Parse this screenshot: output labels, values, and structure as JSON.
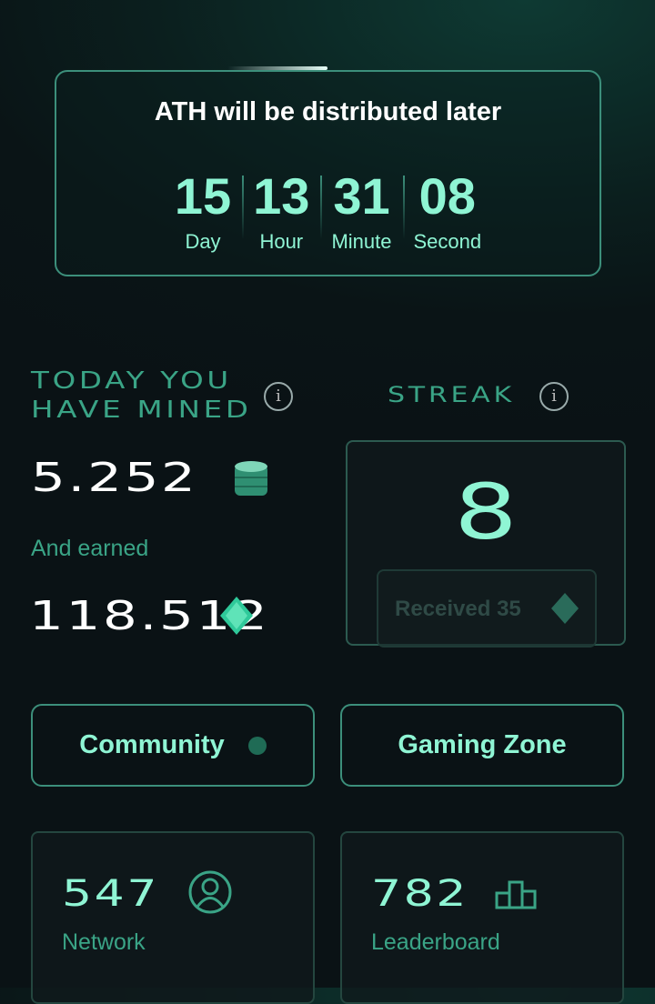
{
  "countdown": {
    "title": "ATH will be distributed later",
    "units": [
      {
        "value": "15",
        "label": "Day"
      },
      {
        "value": "13",
        "label": "Hour"
      },
      {
        "value": "31",
        "label": "Minute"
      },
      {
        "value": "08",
        "label": "Second"
      }
    ]
  },
  "mined": {
    "heading_line1": "TODAY YOU",
    "heading_line2": "HAVE MINED",
    "amount": "5.252",
    "icon": "coin-stack-icon",
    "earned_label": "And earned",
    "earned": "118.512",
    "earned_icon": "gem-icon"
  },
  "streak": {
    "heading": "STREAK",
    "value": "8",
    "received": "Received 35"
  },
  "buttons": {
    "community": "Community",
    "gaming": "Gaming Zone"
  },
  "stats": [
    {
      "value": "547",
      "label": "Network",
      "icon": "user-icon"
    },
    {
      "value": "782",
      "label": "Leaderboard",
      "icon": "podium-icon"
    }
  ],
  "colors": {
    "accent": "#8ff5d4",
    "muted": "#3aa486",
    "border": "#3c8f7b"
  }
}
